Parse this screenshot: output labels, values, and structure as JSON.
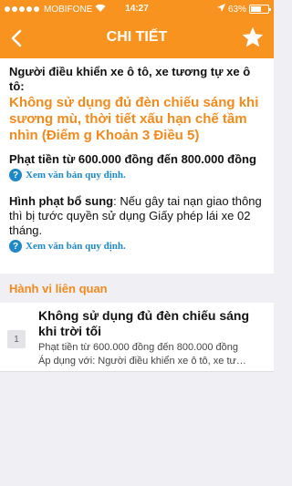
{
  "status_bar": {
    "carrier": "MOBIFONE",
    "time": "14:27",
    "battery_percent_text": "63%",
    "battery_level": 0.63
  },
  "nav": {
    "title": "CHI TIẾT",
    "back_icon": "chevron-left-icon",
    "favorite_icon": "star-icon"
  },
  "detail": {
    "subject": "Người điều khiển xe ô tô, xe tương tự xe ô tô:",
    "violation": "Không sử dụng đủ đèn chiếu sáng khi sương mù, thời tiết xấu hạn chế tầm nhìn (Điểm g Khoản 3 Điều 5)",
    "fine": "Phạt tiền từ 600.000 đồng đến 800.000 đồng",
    "doc_link_1": "Xem văn bản quy định.",
    "extra_label": "Hình phạt bổ sung",
    "extra_text": ": Nếu gây tai nạn giao thông thì bị tước quyền sử dụng Giấy phép lái xe 02 tháng.",
    "doc_link_2": "Xem văn bản quy định."
  },
  "related": {
    "header": "Hành vi liên quan",
    "items": [
      {
        "number": "1",
        "title": "Không sử dụng đủ đèn chiếu sáng khi trời tối",
        "fine": "Phạt tiền từ 600.000 đồng đến 800.000 đồng",
        "applies": "Áp dụng với: Người điều khiển xe ô tô, xe tư…"
      }
    ]
  },
  "colors": {
    "header_bg": "#f7931e",
    "accent_text": "#f28a1c",
    "link": "#1e88c8"
  }
}
